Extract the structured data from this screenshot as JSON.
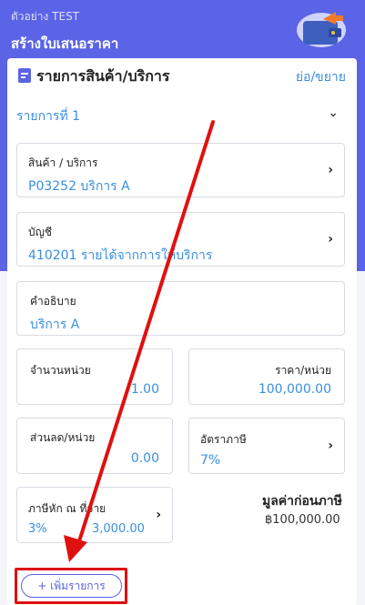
{
  "header": {
    "subtitle": "ตัวอย่าง TEST",
    "title": "สร้างใบเสนอราคา"
  },
  "section": {
    "title": "รายการสินค้า/บริการ",
    "toggle": "ย่อ/ขยาย"
  },
  "item": {
    "title": "รายการที่ 1",
    "product": {
      "label": "สินค้า / บริการ",
      "value": "P03252 บริการ A"
    },
    "account": {
      "label": "บัญชี",
      "value": "410201 รายได้จากการให้บริการ"
    },
    "description": {
      "label": "คำอธิบาย",
      "value": "บริการ A"
    },
    "quantity": {
      "label": "จำนวนหน่วย",
      "value": "1.00"
    },
    "price": {
      "label": "ราคา/หน่วย",
      "value": "100,000.00"
    },
    "discount": {
      "label": "ส่วนลด/หน่วย",
      "value": "0.00"
    },
    "tax": {
      "label": "อัตราภาษี",
      "value": "7%"
    },
    "withholding": {
      "label": "ภาษีหัก ณ ที่จ่าย",
      "rate": "3%",
      "amount": "3,000.00"
    },
    "subtotal": {
      "label": "มูลค่าก่อนภาษี",
      "value": "฿100,000.00"
    }
  },
  "add_button": {
    "label": "+ เพิ่มรายการ"
  },
  "colors": {
    "primary": "#5b63e6",
    "link": "#3a8fe0",
    "annotation": "#e01010"
  }
}
